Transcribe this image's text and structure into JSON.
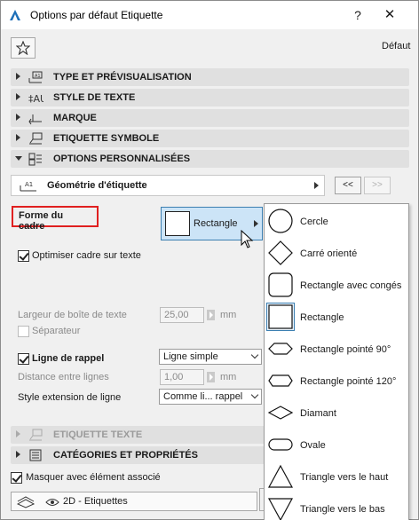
{
  "window": {
    "title": "Options par défaut Etiquette",
    "help_label": "?",
    "close_label": "✕"
  },
  "favorites": {
    "star_icon": "star-outline-icon",
    "default_label": "Défaut"
  },
  "sections": [
    {
      "label": "TYPE ET PRÉVISUALISATION",
      "icon": "label-type-icon",
      "expanded": false
    },
    {
      "label": "STYLE DE TEXTE",
      "icon": "text-style-icon",
      "expanded": false
    },
    {
      "label": "MARQUE",
      "icon": "marker-icon",
      "expanded": false
    },
    {
      "label": "ETIQUETTE SYMBOLE",
      "icon": "symbol-label-icon",
      "expanded": false
    },
    {
      "label": "OPTIONS PERSONNALISÉES",
      "icon": "custom-options-icon",
      "expanded": true
    },
    {
      "label": "ETIQUETTE TEXTE",
      "icon": "text-label-icon",
      "expanded": false,
      "disabled": true
    },
    {
      "label": "CATÉGORIES ET PROPRIÉTÉS",
      "icon": "categories-icon",
      "expanded": false
    }
  ],
  "custom_options": {
    "geometry_label": "Géométrie d'étiquette",
    "prev_label": "<<",
    "next_label": ">>",
    "frame_shape_label": "Forme du cadre",
    "frame_shape_value": "Rectangle",
    "optimize_label": "Optimiser cadre sur texte",
    "optimize_checked": true,
    "box_width_label": "Largeur de boîte de texte",
    "box_width_value": "25,00",
    "box_width_unit": "mm",
    "separator_label": "Séparateur",
    "leader_label": "Ligne de rappel",
    "leader_checked": true,
    "leader_type": "Ligne simple",
    "line_spacing_label": "Distance entre lignes",
    "line_spacing_value": "1,00",
    "line_spacing_unit": "mm",
    "extension_style_label": "Style extension de ligne",
    "extension_style_value": "Comme li... rappel"
  },
  "bottom": {
    "associate_label": "Masquer avec élément associé",
    "associate_checked": true,
    "layer_label": "2D - Etiquettes"
  },
  "shape_menu": {
    "selected": "Rectangle",
    "items": [
      {
        "label": "Cercle",
        "icon": "circle-icon"
      },
      {
        "label": "Carré orienté",
        "icon": "rotated-square-icon"
      },
      {
        "label": "Rectangle avec congés",
        "icon": "rounded-rectangle-icon"
      },
      {
        "label": "Rectangle",
        "icon": "rectangle-icon"
      },
      {
        "label": "Rectangle pointé 90°",
        "icon": "pointed-rectangle-90-icon"
      },
      {
        "label": "Rectangle pointé 120°",
        "icon": "pointed-rectangle-120-icon"
      },
      {
        "label": "Diamant",
        "icon": "diamond-icon"
      },
      {
        "label": "Ovale",
        "icon": "oval-icon"
      },
      {
        "label": "Triangle vers le haut",
        "icon": "triangle-up-icon"
      },
      {
        "label": "Triangle vers le bas",
        "icon": "triangle-down-icon"
      }
    ]
  },
  "colors": {
    "highlight_border": "#e02020",
    "selection_fill": "#cce4f7",
    "selection_border": "#3c7fb1"
  }
}
